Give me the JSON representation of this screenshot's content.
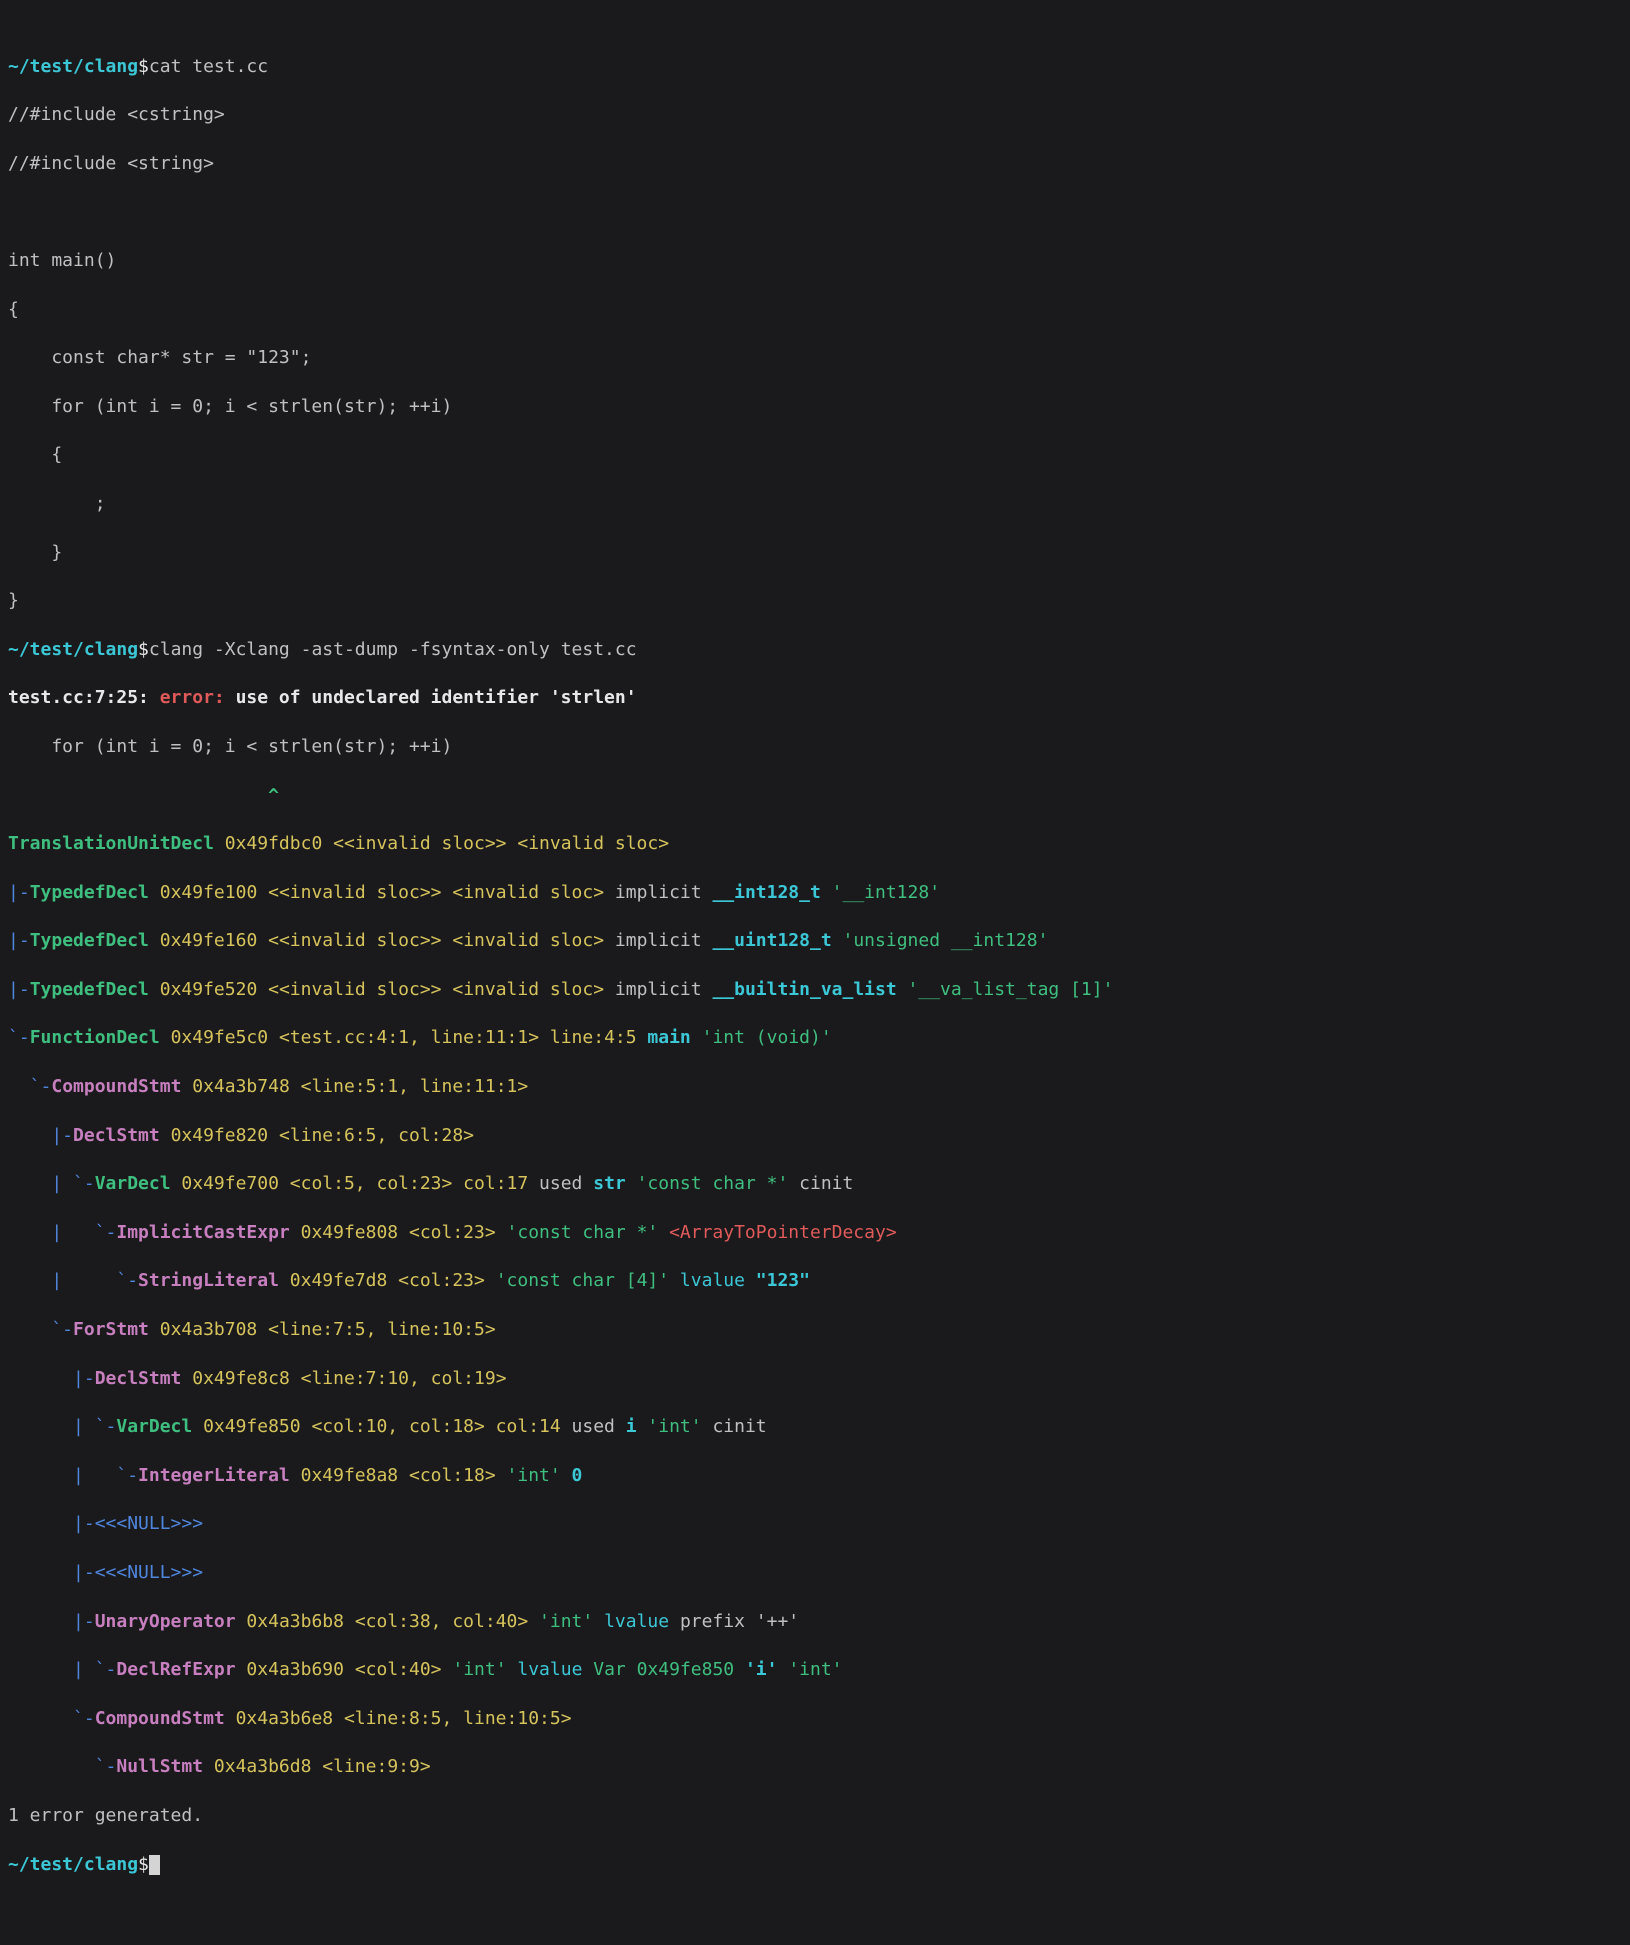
{
  "prompt1": {
    "path": "~/test/clang",
    "symbol": "$",
    "cmd": "cat test.cc"
  },
  "src": {
    "l1": "//#include <cstring>",
    "l2": "//#include <string>",
    "l3": "",
    "l4": "int main()",
    "l5": "{",
    "l6": "    const char* str = \"123\";",
    "l7": "    for (int i = 0; i < strlen(str); ++i)",
    "l8": "    {",
    "l9": "        ;",
    "l10": "    }",
    "l11": "}"
  },
  "prompt2": {
    "path": "~/test/clang",
    "symbol": "$",
    "cmd": "clang -Xclang -ast-dump -fsyntax-only test.cc"
  },
  "err": {
    "loc": "test.cc:7:25: ",
    "tag": "error: ",
    "msg": "use of undeclared identifier 'strlen'",
    "src": "    for (int i = 0; i < strlen(str); ++i)",
    "caret": "                        ^"
  },
  "ast": {
    "tu": {
      "name": "TranslationUnitDecl",
      "addr": " 0x49fdbc0 ",
      "sloc": "<<invalid sloc>> <invalid sloc>"
    },
    "td1": {
      "pipe": "|-",
      "name": "TypedefDecl",
      "addr": " 0x49fe100 ",
      "sloc": "<<invalid sloc>> <invalid sloc>",
      "impl": " implicit ",
      "id": "__int128_t",
      "type": " '__int128'"
    },
    "td2": {
      "pipe": "|-",
      "name": "TypedefDecl",
      "addr": " 0x49fe160 ",
      "sloc": "<<invalid sloc>> <invalid sloc>",
      "impl": " implicit ",
      "id": "__uint128_t",
      "type": " 'unsigned __int128'"
    },
    "td3": {
      "pipe": "|-",
      "name": "TypedefDecl",
      "addr": " 0x49fe520 ",
      "sloc": "<<invalid sloc>> <invalid sloc>",
      "impl": " implicit ",
      "id": "__builtin_va_list",
      "type": " '__va_list_tag [1]'"
    },
    "fn": {
      "pipe": "`-",
      "name": "FunctionDecl",
      "addr": " 0x49fe5c0 ",
      "sloc": "<test.cc:4:1, line:11:1>",
      "pos": " line:4:5 ",
      "id": "main",
      "type": " 'int (void)'"
    },
    "cs1": {
      "pipe": "  `-",
      "name": "CompoundStmt",
      "addr": " 0x4a3b748 ",
      "sloc": "<line:5:1, line:11:1>"
    },
    "ds1": {
      "pipe": "    |-",
      "name": "DeclStmt",
      "addr": " 0x49fe820 ",
      "sloc": "<line:6:5, col:28>"
    },
    "vd1": {
      "pipe": "    | `-",
      "name": "VarDecl",
      "addr": " 0x49fe700 ",
      "sloc": "<col:5, col:23>",
      "pos": " col:17 ",
      "used": "used ",
      "id": "str",
      "type": " 'const char *'",
      "init": " cinit"
    },
    "ice": {
      "pipe": "    |   `-",
      "name": "ImplicitCastExpr",
      "addr": " 0x49fe808 ",
      "sloc": "<col:23>",
      "type": " 'const char *' ",
      "kind": "<ArrayToPointerDecay>"
    },
    "sl": {
      "pipe": "    |     `-",
      "name": "StringLiteral",
      "addr": " 0x49fe7d8 ",
      "sloc": "<col:23>",
      "type": " 'const char [4]'",
      "lval": " lvalue ",
      "val": "\"123\""
    },
    "for": {
      "pipe": "    `-",
      "name": "ForStmt",
      "addr": " 0x4a3b708 ",
      "sloc": "<line:7:5, line:10:5>"
    },
    "ds2": {
      "pipe": "      |-",
      "name": "DeclStmt",
      "addr": " 0x49fe8c8 ",
      "sloc": "<line:7:10, col:19>"
    },
    "vd2": {
      "pipe": "      | `-",
      "name": "VarDecl",
      "addr": " 0x49fe850 ",
      "sloc": "<col:10, col:18>",
      "pos": " col:14 ",
      "used": "used ",
      "id": "i",
      "type": " 'int'",
      "init": " cinit"
    },
    "il": {
      "pipe": "      |   `-",
      "name": "IntegerLiteral",
      "addr": " 0x49fe8a8 ",
      "sloc": "<col:18>",
      "type": " 'int' ",
      "val": "0"
    },
    "n1": {
      "pipe": "      |-",
      "null": "<<<NULL>>>"
    },
    "n2": {
      "pipe": "      |-",
      "null": "<<<NULL>>>"
    },
    "uo": {
      "pipe": "      |-",
      "name": "UnaryOperator",
      "addr": " 0x4a3b6b8 ",
      "sloc": "<col:38, col:40>",
      "type": " 'int'",
      "lval": " lvalue ",
      "rest": "prefix '++'"
    },
    "dre": {
      "pipe": "      | `-",
      "name": "DeclRefExpr",
      "addr": " 0x4a3b690 ",
      "sloc": "<col:40>",
      "type": " 'int'",
      "lval": " lvalue ",
      "kind": "Var 0x49fe850 ",
      "id": "'i'",
      "type2": " 'int'"
    },
    "cs2": {
      "pipe": "      `-",
      "name": "CompoundStmt",
      "addr": " 0x4a3b6e8 ",
      "sloc": "<line:8:5, line:10:5>"
    },
    "ns": {
      "pipe": "        `-",
      "name": "NullStmt",
      "addr": " 0x4a3b6d8 ",
      "sloc": "<line:9:9>"
    }
  },
  "summary": "1 error generated.",
  "prompt3": {
    "path": "~/test/clang",
    "symbol": "$"
  }
}
